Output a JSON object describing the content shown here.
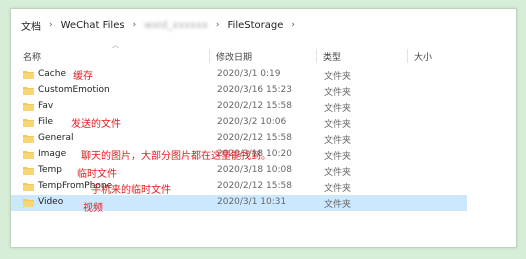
{
  "breadcrumb": {
    "items": [
      "文档",
      "WeChat Files",
      "",
      "FileStorage"
    ]
  },
  "columns": {
    "name": "名称",
    "date": "修改日期",
    "type": "类型",
    "size": "大小"
  },
  "rows": [
    {
      "name": "Cache",
      "date": "2020/3/1 0:19",
      "type": "文件夹",
      "note": "缓存"
    },
    {
      "name": "CustomEmotion",
      "date": "2020/3/16 15:23",
      "type": "文件夹",
      "note": ""
    },
    {
      "name": "Fav",
      "date": "2020/2/12 15:58",
      "type": "文件夹",
      "note": ""
    },
    {
      "name": "File",
      "date": "2020/3/2 10:06",
      "type": "文件夹",
      "note": "发送的文件"
    },
    {
      "name": "General",
      "date": "2020/2/12 15:58",
      "type": "文件夹",
      "note": ""
    },
    {
      "name": "Image",
      "date": "2020/3/18 10:20",
      "type": "文件夹",
      "note": "聊天的图片，大部分图片都在这里能找到。"
    },
    {
      "name": "Temp",
      "date": "2020/3/18 10:08",
      "type": "文件夹",
      "note": "临时文件"
    },
    {
      "name": "TempFromPhone",
      "date": "2020/2/12 15:58",
      "type": "文件夹",
      "note": "手机来的临时文件"
    },
    {
      "name": "Video",
      "date": "2020/3/1 10:31",
      "type": "文件夹",
      "note": "视频"
    }
  ],
  "colors": {
    "folder": "#f3c95a",
    "annotation": "#e02020",
    "selection": "#cce8ff",
    "background": "#d7edd8"
  }
}
